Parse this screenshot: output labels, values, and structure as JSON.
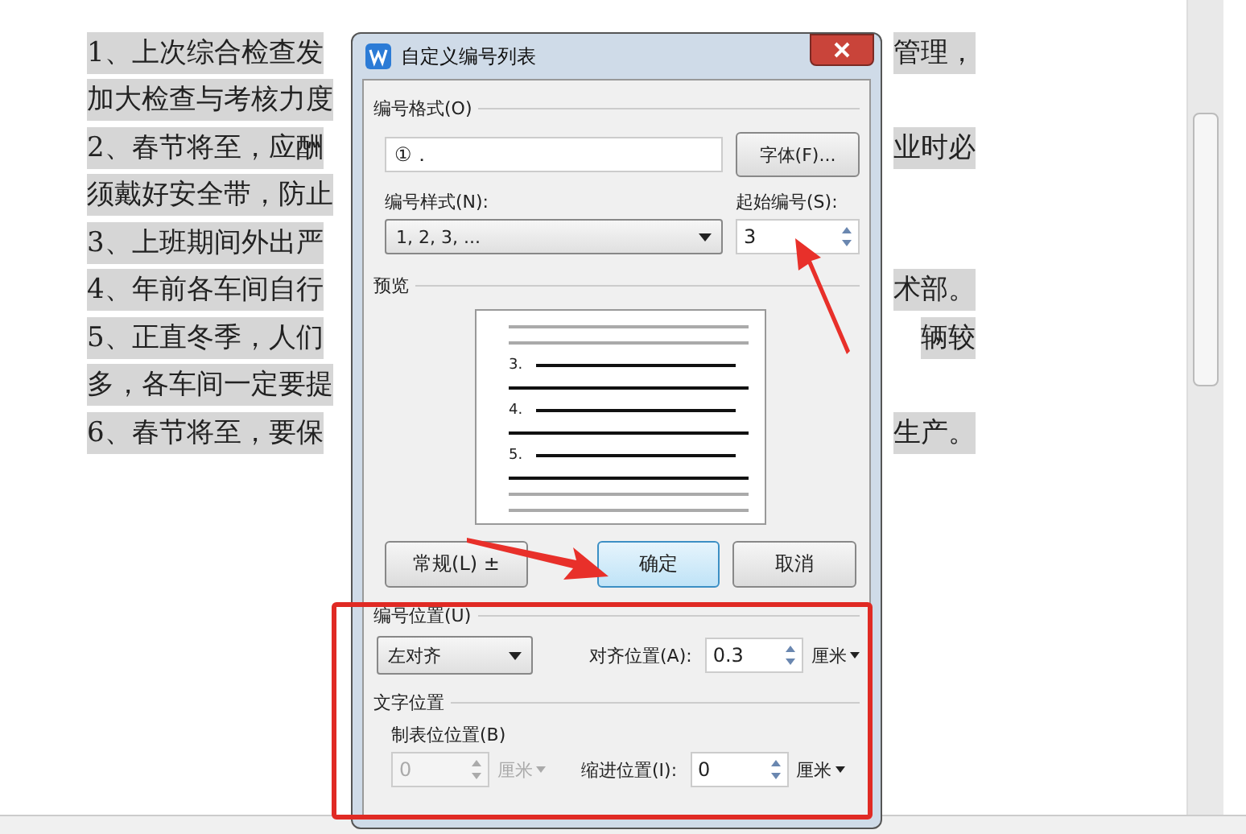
{
  "document": {
    "lines": [
      {
        "left": "1、上次综合检查发",
        "right": "管理，"
      },
      {
        "left": "加大检查与考核力度"
      },
      {
        "left": "2、春节将至，应酬",
        "right": "业时必"
      },
      {
        "left": "须戴好安全带，防止"
      },
      {
        "left": "3、上班期间外出严"
      },
      {
        "left": "4、年前各车间自行",
        "right": "术部。"
      },
      {
        "left": "5、正直冬季，人们",
        "right": "辆较"
      },
      {
        "left": "多，各车间一定要提"
      },
      {
        "left": "6、春节将至，要保",
        "right": "生产。"
      }
    ]
  },
  "dialog": {
    "title": "自定义编号列表",
    "format_section": "编号格式(O)",
    "format_value": "①．",
    "font_button": "字体(F)...",
    "style_label": "编号样式(N):",
    "style_value": "1, 2, 3, ...",
    "start_label": "起始编号(S):",
    "start_value": "3",
    "preview_section": "预览",
    "preview_items": [
      "3.",
      "4.",
      "5."
    ],
    "buttons": [
      {
        "label": "常规(L) ±",
        "default": false
      },
      {
        "label": "确定",
        "default": true
      },
      {
        "label": "取消",
        "default": false
      }
    ],
    "number_position_section": "编号位置(U)",
    "align_value": "左对齐",
    "align_pos_label": "对齐位置(A):",
    "align_pos_value": "0.3",
    "align_pos_unit": "厘米",
    "text_position_section": "文字位置",
    "tab_label": "制表位位置(B)",
    "tab_field": {
      "value": "0",
      "unit": "厘米",
      "disabled": true
    },
    "indent_label": "缩进位置(I):",
    "indent_field": {
      "value": "0",
      "unit": "厘米",
      "disabled": false
    }
  }
}
